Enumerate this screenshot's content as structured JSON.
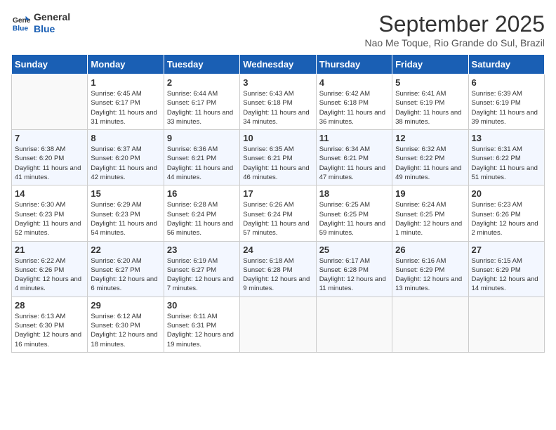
{
  "logo": {
    "text1": "General",
    "text2": "Blue"
  },
  "title": "September 2025",
  "subtitle": "Nao Me Toque, Rio Grande do Sul, Brazil",
  "days_of_week": [
    "Sunday",
    "Monday",
    "Tuesday",
    "Wednesday",
    "Thursday",
    "Friday",
    "Saturday"
  ],
  "weeks": [
    [
      {
        "day": "",
        "sunrise": "",
        "sunset": "",
        "daylight": ""
      },
      {
        "day": "1",
        "sunrise": "Sunrise: 6:45 AM",
        "sunset": "Sunset: 6:17 PM",
        "daylight": "Daylight: 11 hours and 31 minutes."
      },
      {
        "day": "2",
        "sunrise": "Sunrise: 6:44 AM",
        "sunset": "Sunset: 6:17 PM",
        "daylight": "Daylight: 11 hours and 33 minutes."
      },
      {
        "day": "3",
        "sunrise": "Sunrise: 6:43 AM",
        "sunset": "Sunset: 6:18 PM",
        "daylight": "Daylight: 11 hours and 34 minutes."
      },
      {
        "day": "4",
        "sunrise": "Sunrise: 6:42 AM",
        "sunset": "Sunset: 6:18 PM",
        "daylight": "Daylight: 11 hours and 36 minutes."
      },
      {
        "day": "5",
        "sunrise": "Sunrise: 6:41 AM",
        "sunset": "Sunset: 6:19 PM",
        "daylight": "Daylight: 11 hours and 38 minutes."
      },
      {
        "day": "6",
        "sunrise": "Sunrise: 6:39 AM",
        "sunset": "Sunset: 6:19 PM",
        "daylight": "Daylight: 11 hours and 39 minutes."
      }
    ],
    [
      {
        "day": "7",
        "sunrise": "Sunrise: 6:38 AM",
        "sunset": "Sunset: 6:20 PM",
        "daylight": "Daylight: 11 hours and 41 minutes."
      },
      {
        "day": "8",
        "sunrise": "Sunrise: 6:37 AM",
        "sunset": "Sunset: 6:20 PM",
        "daylight": "Daylight: 11 hours and 42 minutes."
      },
      {
        "day": "9",
        "sunrise": "Sunrise: 6:36 AM",
        "sunset": "Sunset: 6:21 PM",
        "daylight": "Daylight: 11 hours and 44 minutes."
      },
      {
        "day": "10",
        "sunrise": "Sunrise: 6:35 AM",
        "sunset": "Sunset: 6:21 PM",
        "daylight": "Daylight: 11 hours and 46 minutes."
      },
      {
        "day": "11",
        "sunrise": "Sunrise: 6:34 AM",
        "sunset": "Sunset: 6:21 PM",
        "daylight": "Daylight: 11 hours and 47 minutes."
      },
      {
        "day": "12",
        "sunrise": "Sunrise: 6:32 AM",
        "sunset": "Sunset: 6:22 PM",
        "daylight": "Daylight: 11 hours and 49 minutes."
      },
      {
        "day": "13",
        "sunrise": "Sunrise: 6:31 AM",
        "sunset": "Sunset: 6:22 PM",
        "daylight": "Daylight: 11 hours and 51 minutes."
      }
    ],
    [
      {
        "day": "14",
        "sunrise": "Sunrise: 6:30 AM",
        "sunset": "Sunset: 6:23 PM",
        "daylight": "Daylight: 11 hours and 52 minutes."
      },
      {
        "day": "15",
        "sunrise": "Sunrise: 6:29 AM",
        "sunset": "Sunset: 6:23 PM",
        "daylight": "Daylight: 11 hours and 54 minutes."
      },
      {
        "day": "16",
        "sunrise": "Sunrise: 6:28 AM",
        "sunset": "Sunset: 6:24 PM",
        "daylight": "Daylight: 11 hours and 56 minutes."
      },
      {
        "day": "17",
        "sunrise": "Sunrise: 6:26 AM",
        "sunset": "Sunset: 6:24 PM",
        "daylight": "Daylight: 11 hours and 57 minutes."
      },
      {
        "day": "18",
        "sunrise": "Sunrise: 6:25 AM",
        "sunset": "Sunset: 6:25 PM",
        "daylight": "Daylight: 11 hours and 59 minutes."
      },
      {
        "day": "19",
        "sunrise": "Sunrise: 6:24 AM",
        "sunset": "Sunset: 6:25 PM",
        "daylight": "Daylight: 12 hours and 1 minute."
      },
      {
        "day": "20",
        "sunrise": "Sunrise: 6:23 AM",
        "sunset": "Sunset: 6:26 PM",
        "daylight": "Daylight: 12 hours and 2 minutes."
      }
    ],
    [
      {
        "day": "21",
        "sunrise": "Sunrise: 6:22 AM",
        "sunset": "Sunset: 6:26 PM",
        "daylight": "Daylight: 12 hours and 4 minutes."
      },
      {
        "day": "22",
        "sunrise": "Sunrise: 6:20 AM",
        "sunset": "Sunset: 6:27 PM",
        "daylight": "Daylight: 12 hours and 6 minutes."
      },
      {
        "day": "23",
        "sunrise": "Sunrise: 6:19 AM",
        "sunset": "Sunset: 6:27 PM",
        "daylight": "Daylight: 12 hours and 7 minutes."
      },
      {
        "day": "24",
        "sunrise": "Sunrise: 6:18 AM",
        "sunset": "Sunset: 6:28 PM",
        "daylight": "Daylight: 12 hours and 9 minutes."
      },
      {
        "day": "25",
        "sunrise": "Sunrise: 6:17 AM",
        "sunset": "Sunset: 6:28 PM",
        "daylight": "Daylight: 12 hours and 11 minutes."
      },
      {
        "day": "26",
        "sunrise": "Sunrise: 6:16 AM",
        "sunset": "Sunset: 6:29 PM",
        "daylight": "Daylight: 12 hours and 13 minutes."
      },
      {
        "day": "27",
        "sunrise": "Sunrise: 6:15 AM",
        "sunset": "Sunset: 6:29 PM",
        "daylight": "Daylight: 12 hours and 14 minutes."
      }
    ],
    [
      {
        "day": "28",
        "sunrise": "Sunrise: 6:13 AM",
        "sunset": "Sunset: 6:30 PM",
        "daylight": "Daylight: 12 hours and 16 minutes."
      },
      {
        "day": "29",
        "sunrise": "Sunrise: 6:12 AM",
        "sunset": "Sunset: 6:30 PM",
        "daylight": "Daylight: 12 hours and 18 minutes."
      },
      {
        "day": "30",
        "sunrise": "Sunrise: 6:11 AM",
        "sunset": "Sunset: 6:31 PM",
        "daylight": "Daylight: 12 hours and 19 minutes."
      },
      {
        "day": "",
        "sunrise": "",
        "sunset": "",
        "daylight": ""
      },
      {
        "day": "",
        "sunrise": "",
        "sunset": "",
        "daylight": ""
      },
      {
        "day": "",
        "sunrise": "",
        "sunset": "",
        "daylight": ""
      },
      {
        "day": "",
        "sunrise": "",
        "sunset": "",
        "daylight": ""
      }
    ]
  ]
}
